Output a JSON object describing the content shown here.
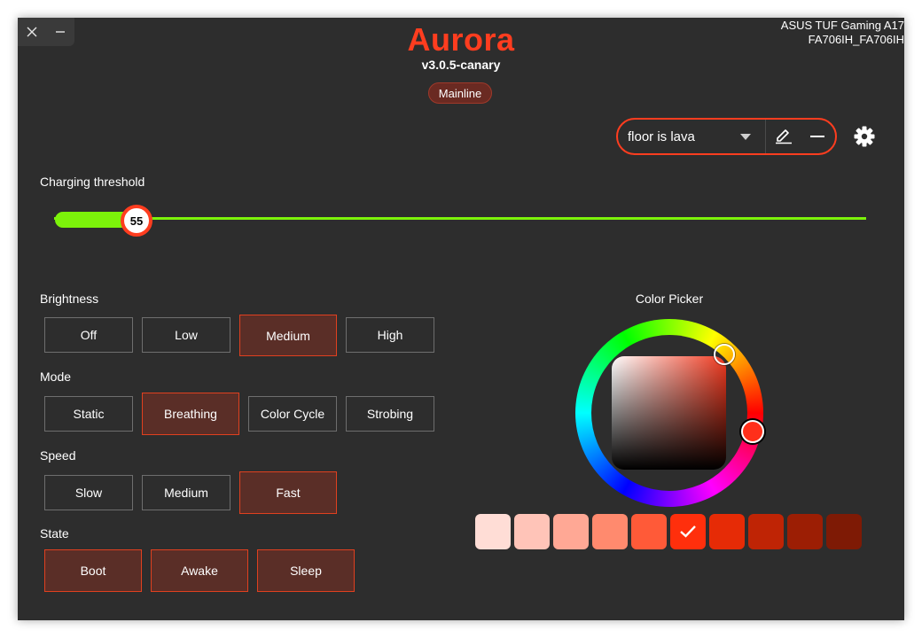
{
  "app": {
    "title": "Aurora",
    "version": "v3.0.5-canary",
    "channel": "Mainline"
  },
  "device": {
    "line1": "ASUS TUF Gaming A17",
    "line2": "FA706IH_FA706IH"
  },
  "window_controls": {
    "close_icon": "close-icon",
    "minimize_icon": "minimize-icon"
  },
  "profile": {
    "selected": "floor is lava",
    "edit_icon": "pencil-icon",
    "remove_icon": "minus-icon",
    "settings_icon": "gear-icon"
  },
  "charging": {
    "label": "Charging threshold",
    "value": "55"
  },
  "brightness": {
    "label": "Brightness",
    "options": [
      "Off",
      "Low",
      "Medium",
      "High"
    ],
    "selected": "Medium"
  },
  "mode": {
    "label": "Mode",
    "options": [
      "Static",
      "Breathing",
      "Color Cycle",
      "Strobing"
    ],
    "selected": "Breathing"
  },
  "speed": {
    "label": "Speed",
    "options": [
      "Slow",
      "Medium",
      "Fast"
    ],
    "selected": "Fast"
  },
  "state": {
    "label": "State",
    "options": [
      "Boot",
      "Awake",
      "Sleep"
    ],
    "selected": [
      "Boot",
      "Awake",
      "Sleep"
    ]
  },
  "color_picker": {
    "label": "Color Picker",
    "current_color": "#ff2f1a",
    "swatches": [
      "#ffddd6",
      "#ffc4b8",
      "#ffa895",
      "#ff8a6e",
      "#ff5a38",
      "#ff2f0c",
      "#e62b06",
      "#bf2405",
      "#9c1e04",
      "#7e1a05"
    ],
    "selected_swatch": 5
  },
  "colors": {
    "accent": "#ff3d1f",
    "slider": "#7cf20a",
    "selected_bg": "#5a2e27",
    "window_bg": "#2d2d2d"
  }
}
